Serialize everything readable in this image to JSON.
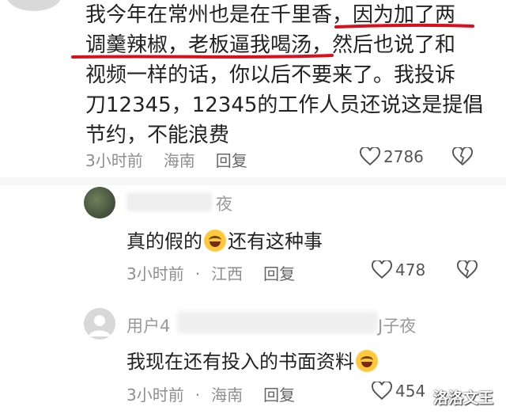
{
  "main_comment": {
    "lines": [
      "我今年在常州也是在千里香，因为加了两",
      "调羹辣椒，老板逼我喝汤，然后也说了和",
      "视频一样的话，你以后不要来了。我投诉",
      "刀12345，12345的工作人员还说这是提倡",
      "节约，不能浪费"
    ],
    "time": "3小时前",
    "location": "海南",
    "reply_label": "回复",
    "likes": "2786"
  },
  "replies": [
    {
      "name_suffix": "夜",
      "text": "真的假的",
      "text_after_emoji": "还有这种事",
      "time": "3小时前",
      "location": "江西",
      "reply_label": "回复",
      "likes": "478"
    },
    {
      "name_prefix": "用户4",
      "name_suffix": "J子夜",
      "text": "我现在还有投入的书面资料",
      "time": "3小时前",
      "location": "海南",
      "reply_label": "回复",
      "likes": "454"
    }
  ],
  "watermark": "洛洛文王",
  "icons": {
    "like": "heart-outline-icon",
    "dislike": "broken-heart-icon",
    "emoji": "rofl-emoji-icon",
    "avatar_default": "default-user-avatar-icon"
  },
  "colors": {
    "underline": "#d80f1c",
    "meta": "#8e8e8e",
    "text": "#222222"
  }
}
